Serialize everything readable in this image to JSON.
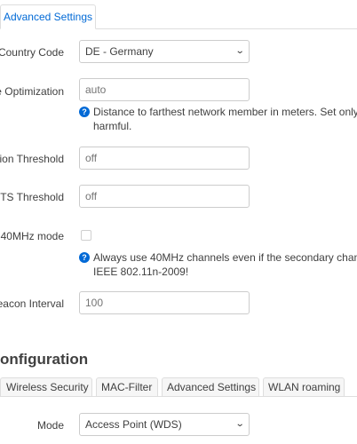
{
  "top_tab": {
    "label": "Advanced Settings"
  },
  "country": {
    "label": "Country Code",
    "value": "DE - Germany"
  },
  "distance": {
    "label": "e Optimization",
    "placeholder": "auto",
    "help": "Distance to farthest network member in meters. Set only\nharmful."
  },
  "frag": {
    "label": "ion Threshold",
    "placeholder": "off"
  },
  "rts": {
    "label": "TS Threshold",
    "placeholder": "off"
  },
  "ht40": {
    "label": "40MHz mode",
    "checked": false,
    "help": "Always use 40MHz channels even if the secondary chan\nIEEE 802.11n-2009!"
  },
  "beacon": {
    "label": "eacon Interval",
    "placeholder": "100"
  },
  "iface": {
    "title": "onfiguration"
  },
  "subtabs": [
    {
      "label": "Wireless Security"
    },
    {
      "label": "MAC-Filter"
    },
    {
      "label": "Advanced Settings"
    },
    {
      "label": "WLAN roaming"
    }
  ],
  "mode": {
    "label": "Mode",
    "value": "Access Point (WDS)"
  },
  "colors": {
    "accent": "#0069d6",
    "border": "#cccccc",
    "text": "#404040",
    "placeholder": "#999999"
  }
}
